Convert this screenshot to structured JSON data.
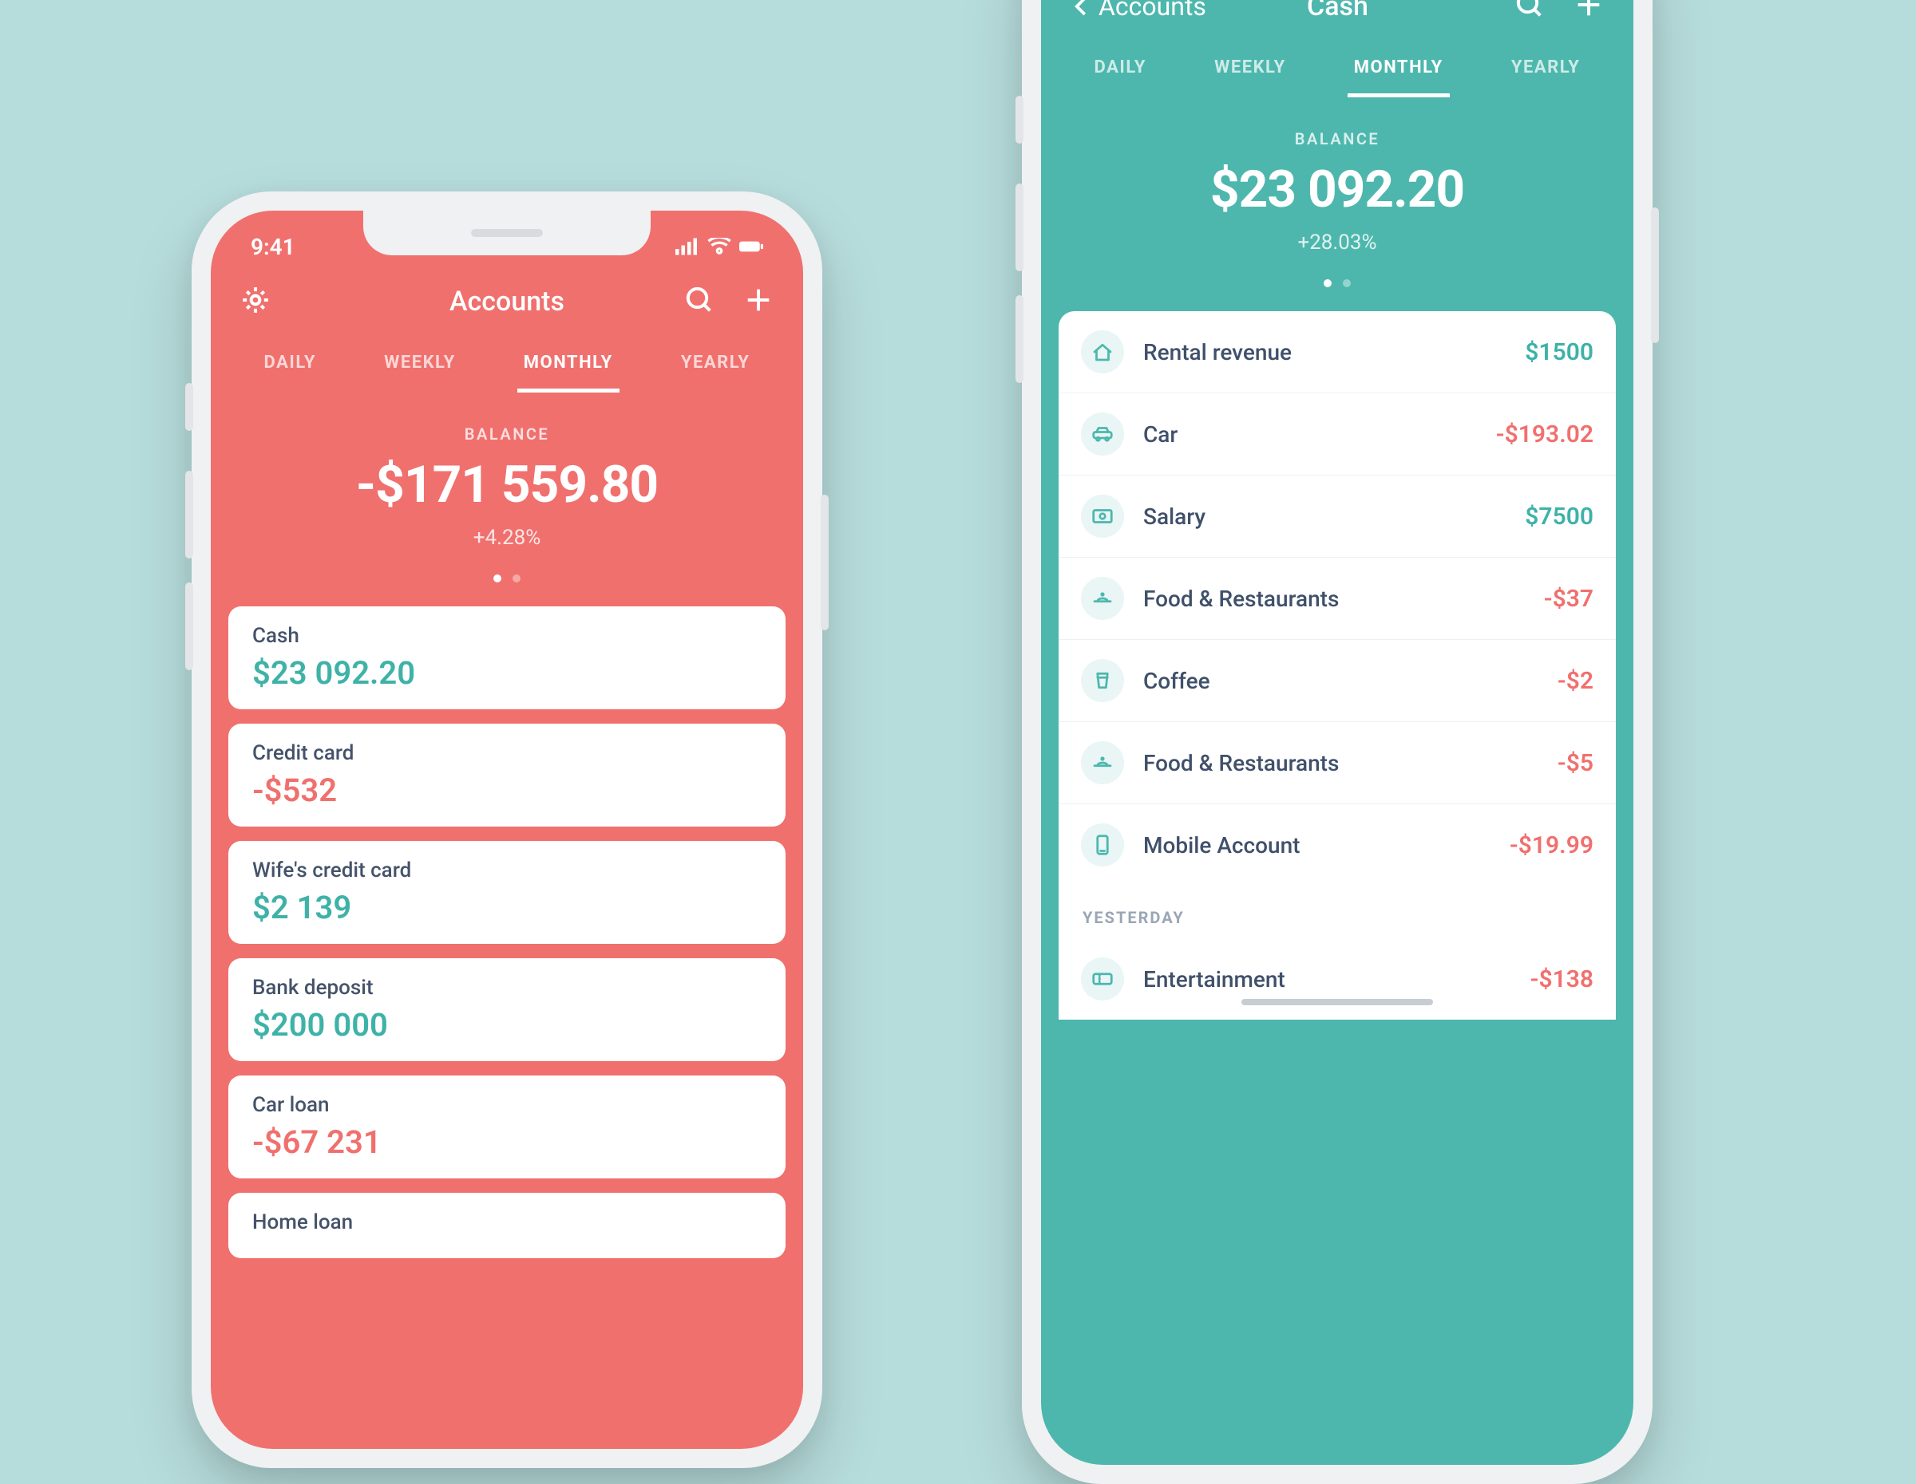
{
  "colors": {
    "red": "#f0706e",
    "teal": "#4db7ad"
  },
  "tabs": [
    "DAILY",
    "WEEKLY",
    "MONTHLY",
    "YEARLY"
  ],
  "tabs_active_index": 2,
  "balance_label": "BALANCE",
  "phone_left": {
    "status_time": "9:41",
    "nav": {
      "title": "Accounts"
    },
    "balance": {
      "value": "-$171 559.80",
      "delta": "+4.28%"
    },
    "accounts": [
      {
        "name": "Cash",
        "amount": "$23 092.20",
        "sign": "pos"
      },
      {
        "name": "Credit card",
        "amount": "-$532",
        "sign": "neg"
      },
      {
        "name": "Wife's credit card",
        "amount": "$2 139",
        "sign": "pos"
      },
      {
        "name": "Bank deposit",
        "amount": "$200 000",
        "sign": "pos"
      },
      {
        "name": "Car loan",
        "amount": "-$67 231",
        "sign": "neg"
      },
      {
        "name": "Home loan",
        "amount": "",
        "sign": "neg"
      }
    ]
  },
  "phone_right": {
    "nav": {
      "back": "Accounts",
      "title": "Cash"
    },
    "balance": {
      "value": "$23 092.20",
      "delta": "+28.03%"
    },
    "transactions": [
      {
        "icon": "home",
        "name": "Rental revenue",
        "amount": "$1500",
        "sign": "pos"
      },
      {
        "icon": "car",
        "name": "Car",
        "amount": "-$193.02",
        "sign": "neg"
      },
      {
        "icon": "money",
        "name": "Salary",
        "amount": "$7500",
        "sign": "pos"
      },
      {
        "icon": "dish",
        "name": "Food & Restaurants",
        "amount": "-$37",
        "sign": "neg"
      },
      {
        "icon": "cup",
        "name": "Coffee",
        "amount": "-$2",
        "sign": "neg"
      },
      {
        "icon": "dish",
        "name": "Food & Restaurants",
        "amount": "-$5",
        "sign": "neg"
      },
      {
        "icon": "phone",
        "name": "Mobile Account",
        "amount": "-$19.99",
        "sign": "neg"
      }
    ],
    "section_header": "YESTERDAY",
    "transactions2": [
      {
        "icon": "ticket",
        "name": "Entertainment",
        "amount": "-$138",
        "sign": "neg"
      }
    ]
  }
}
